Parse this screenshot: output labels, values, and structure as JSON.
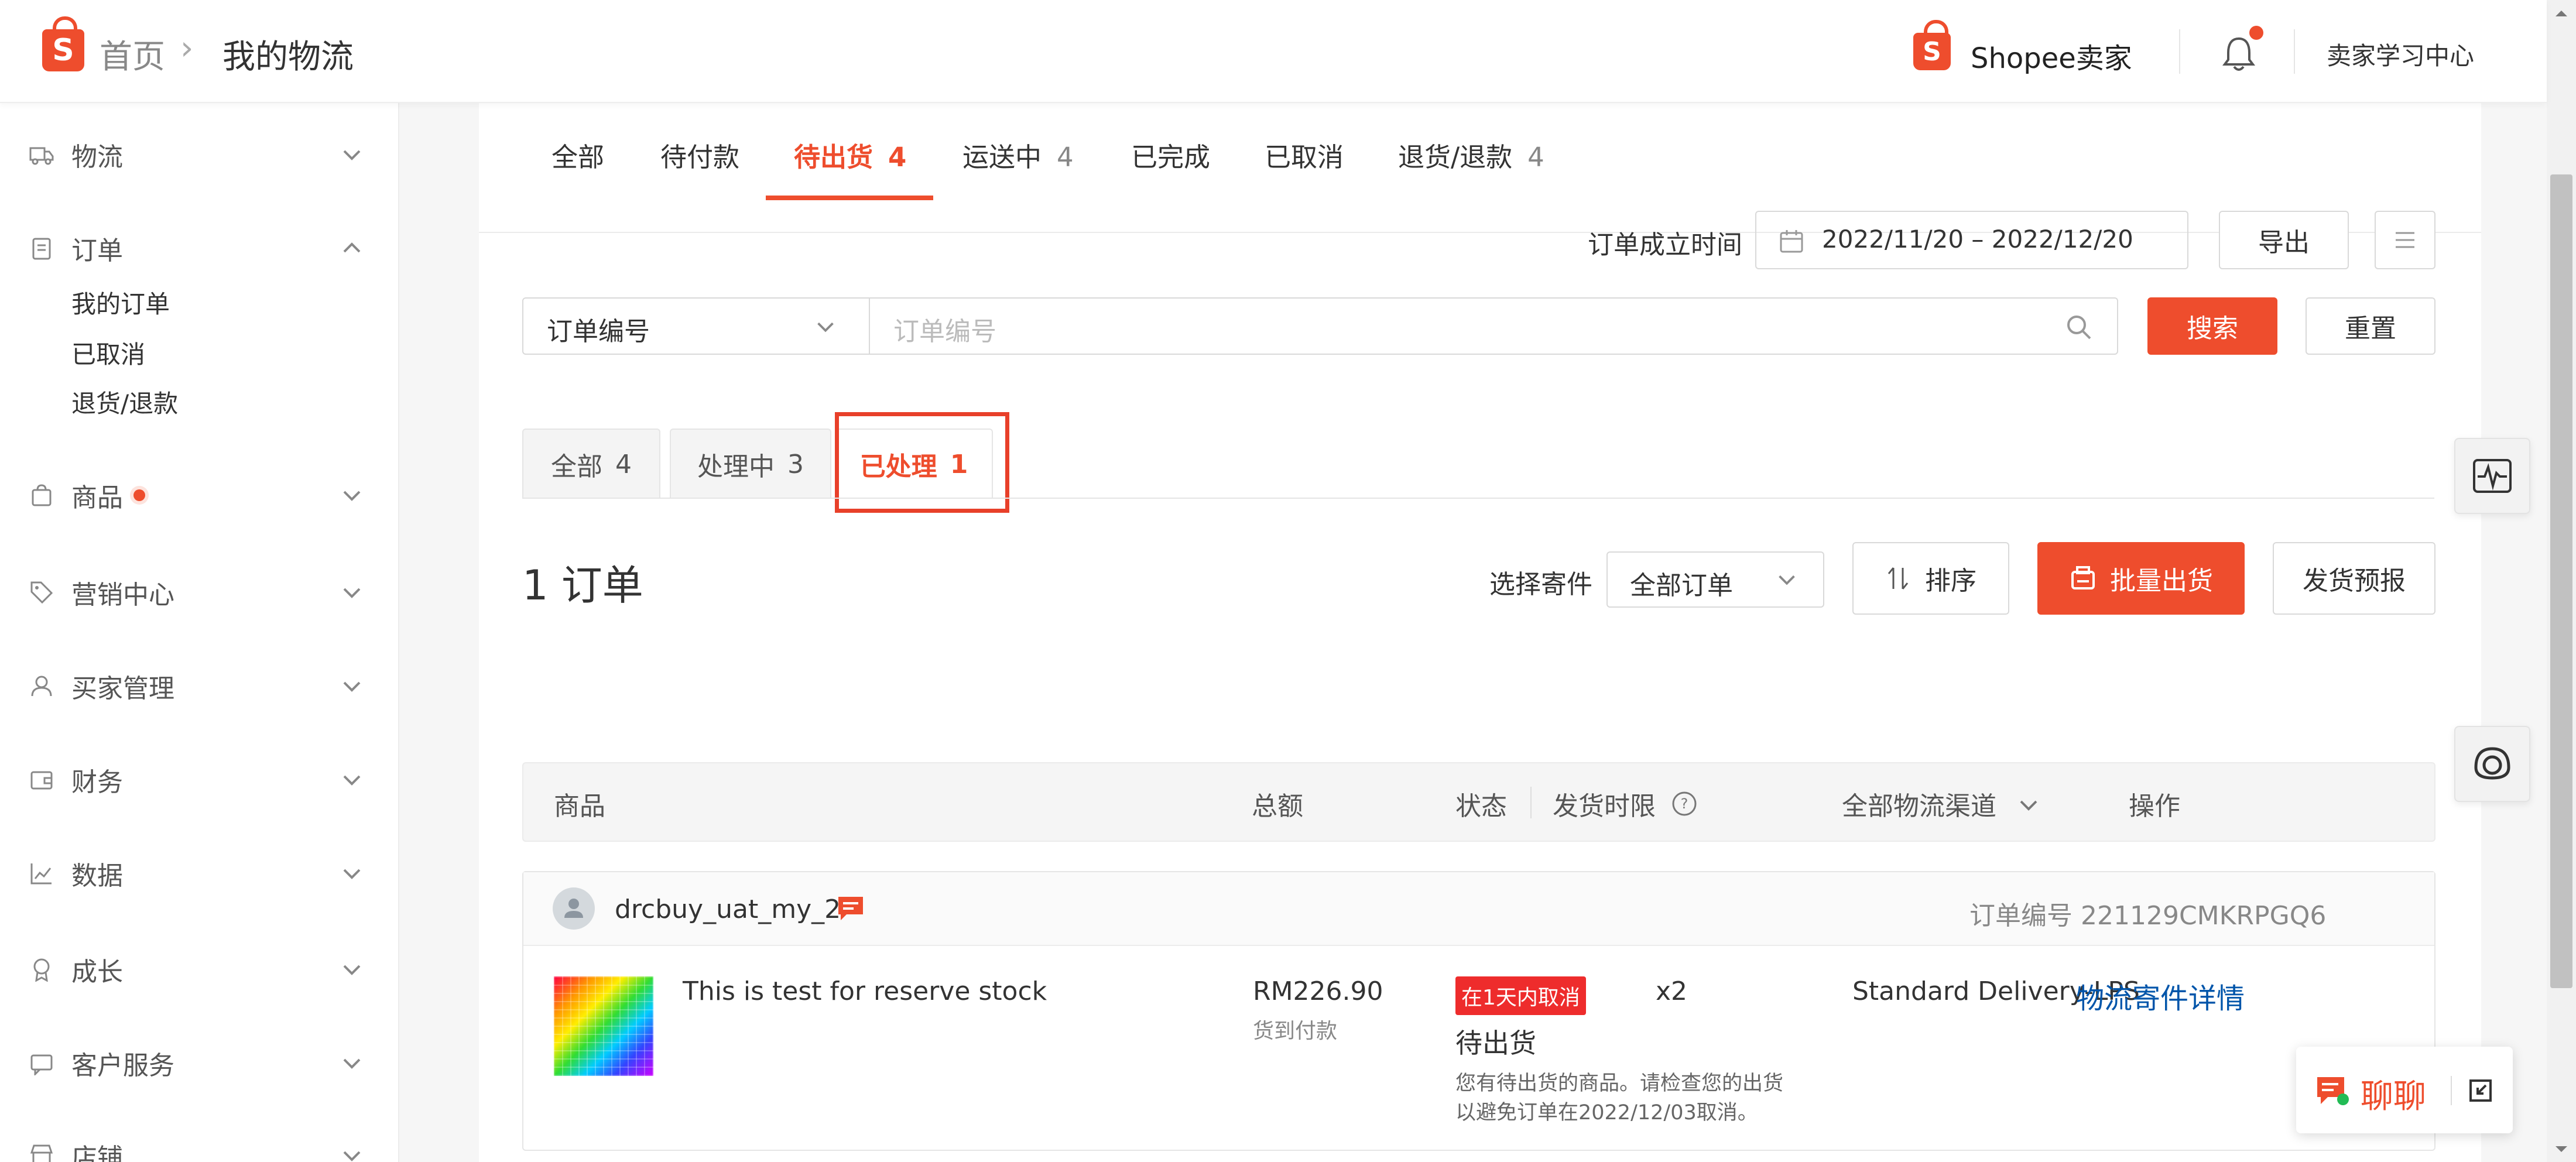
{
  "header": {
    "logo_letter": "S",
    "breadcrumb_home": "首页",
    "breadcrumb_sep": "›",
    "breadcrumb_current": "我的物流",
    "brand_name": "Shopee卖家",
    "learning_center": "卖家学习中心"
  },
  "sidebar": {
    "items": [
      {
        "label": "物流",
        "icon": "truck-icon"
      },
      {
        "label": "订单",
        "icon": "clipboard-icon",
        "expanded": true
      },
      {
        "label": "商品",
        "icon": "bag-icon",
        "dot": true
      },
      {
        "label": "营销中心",
        "icon": "tag-icon"
      },
      {
        "label": "买家管理",
        "icon": "user-icon"
      },
      {
        "label": "财务",
        "icon": "wallet-icon"
      },
      {
        "label": "数据",
        "icon": "chart-icon"
      },
      {
        "label": "成长",
        "icon": "medal-icon"
      },
      {
        "label": "客户服务",
        "icon": "service-icon"
      },
      {
        "label": "店铺",
        "icon": "store-icon"
      }
    ],
    "order_sub": [
      "我的订单",
      "已取消",
      "退货/退款"
    ]
  },
  "status_tabs": [
    {
      "label": "全部",
      "count": ""
    },
    {
      "label": "待付款",
      "count": ""
    },
    {
      "label": "待出货",
      "count": "4",
      "active": true
    },
    {
      "label": "运送中",
      "count": "4"
    },
    {
      "label": "已完成",
      "count": ""
    },
    {
      "label": "已取消",
      "count": ""
    },
    {
      "label": "退货/退款",
      "count": "4"
    }
  ],
  "filters": {
    "date_label": "订单成立时间",
    "date_range": "2022/11/20 – 2022/12/20",
    "export": "导出",
    "search_type": "订单编号",
    "search_placeholder": "订单编号",
    "search_button": "搜索",
    "reset_button": "重置"
  },
  "sub_tabs": [
    {
      "label": "全部",
      "count": "4"
    },
    {
      "label": "处理中",
      "count": "3"
    },
    {
      "label": "已处理",
      "count": "1",
      "active": true
    }
  ],
  "summary": {
    "order_count": "1 订单",
    "select_label": "选择寄件",
    "select_value": "全部订单",
    "sort": "排序",
    "bulk_ship": "批量出货",
    "ship_forecast": "发货预报"
  },
  "table": {
    "headers": {
      "product": "商品",
      "total": "总额",
      "status": "状态",
      "deadline": "发货时限",
      "channel": "全部物流渠道",
      "action": "操作"
    }
  },
  "order": {
    "buyer": "drcbuy_uat_my_2",
    "order_no": "订单编号 221129CMKRPGQ6",
    "product_name": "This is test for reserve stock",
    "qty": "x2",
    "amount": "RM226.90",
    "payment": "货到付款",
    "badge": "在1天内取消",
    "status": "待出货",
    "note_line1": "您有待出货的商品。请检查您的出货",
    "note_line2": "以避免订单在2022/12/03取消。",
    "channel": "Standard Delivery-LPS",
    "action_link": "物流寄件详情"
  },
  "chat": {
    "label": "聊聊"
  },
  "colors": {
    "accent": "#ee4d2d",
    "link": "#0055aa"
  }
}
